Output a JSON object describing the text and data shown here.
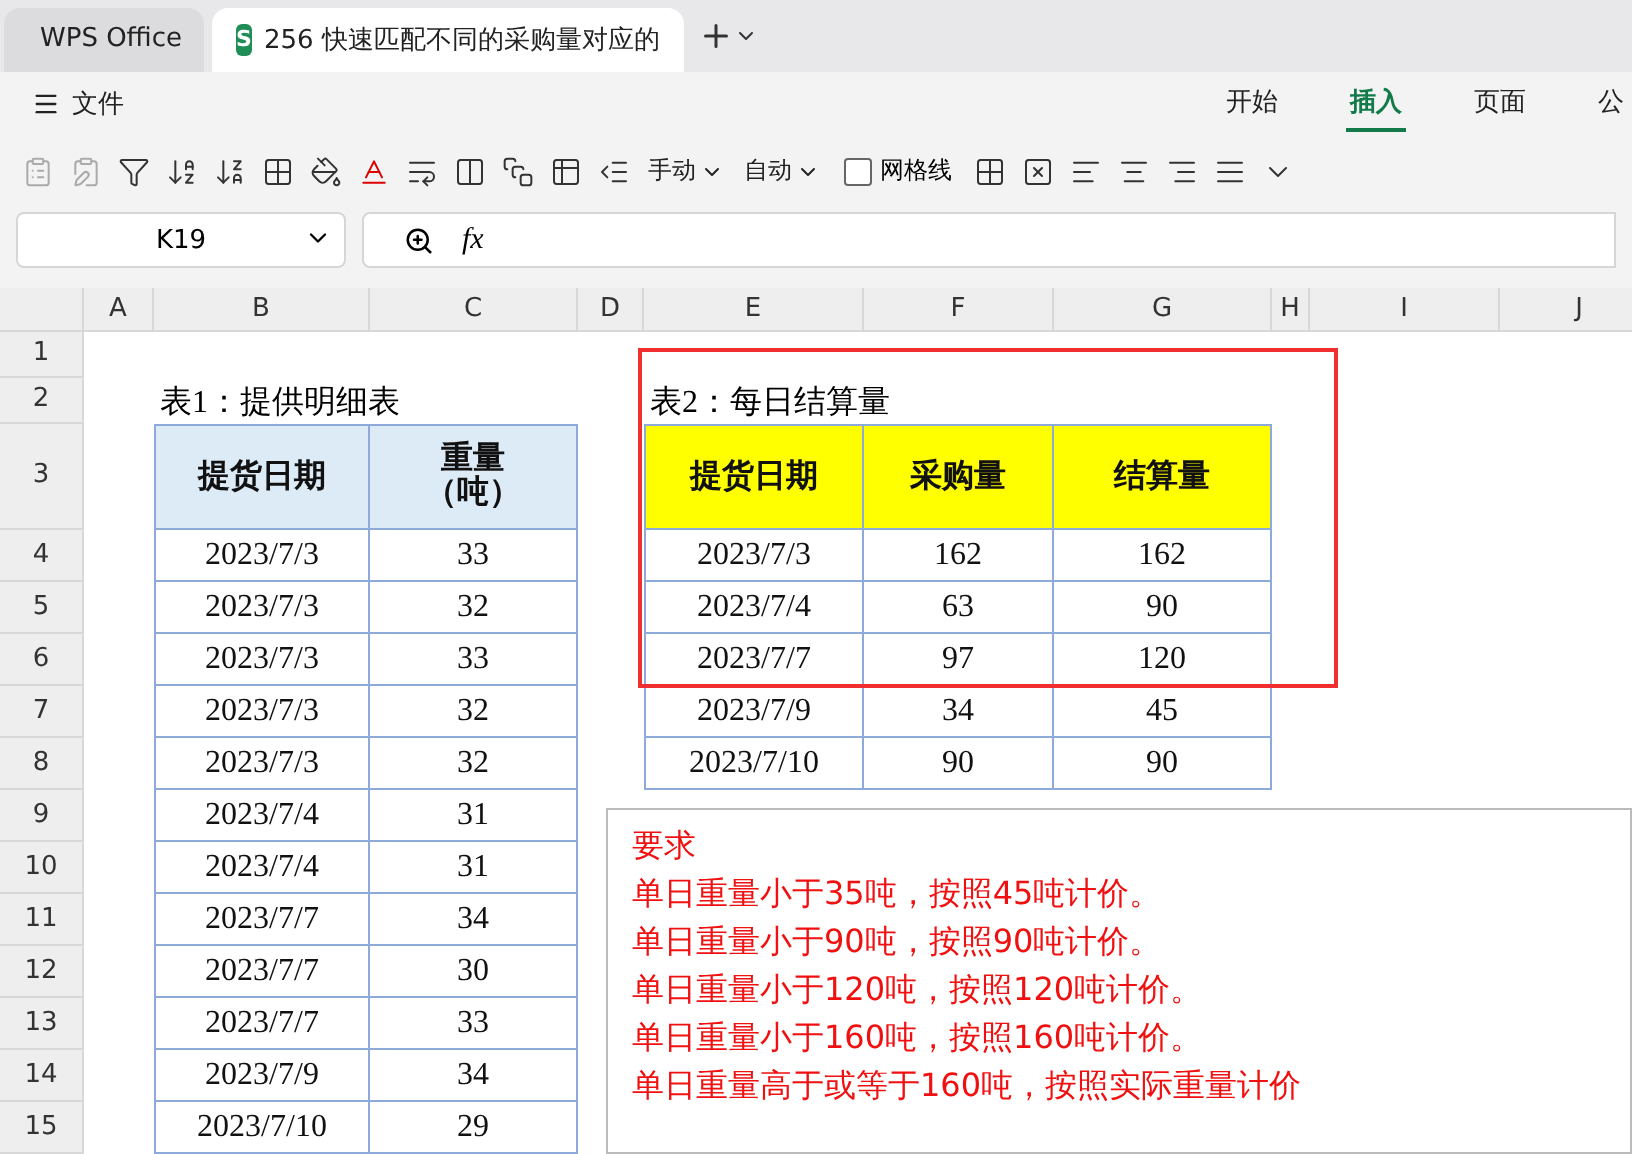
{
  "tabs": [
    {
      "kind": "home",
      "label": "WPS Office",
      "selected": false
    },
    {
      "kind": "doc",
      "badge": "S",
      "label": "256 快速匹配不同的采购量对应的",
      "selected": true
    }
  ],
  "menu": {
    "label": "文件"
  },
  "ribbon_tabs": [
    {
      "label": "开始",
      "selected": false
    },
    {
      "label": "插入",
      "selected": true
    },
    {
      "label": "页面",
      "selected": false
    },
    {
      "label": "公",
      "selected": false
    }
  ],
  "toolbar": [
    {
      "kind": "dropdown",
      "label": "手动"
    },
    {
      "kind": "dropdown",
      "label": "自动"
    },
    {
      "kind": "checkbox",
      "label": "网格线",
      "checked": false
    }
  ],
  "name_box": "K19",
  "formula_label": "fx",
  "sheet": {
    "columns": [
      "A",
      "B",
      "C",
      "D",
      "E",
      "F",
      "G",
      "H",
      "I",
      "J"
    ],
    "rows": [
      "1",
      "2",
      "3",
      "4",
      "5",
      "6",
      "7",
      "8",
      "9",
      "10",
      "11",
      "12",
      "13",
      "14",
      "15"
    ],
    "table1": {
      "title": "表1：提供明细表",
      "headers": [
        [
          "提货日期"
        ],
        [
          "重量",
          "（吨）"
        ]
      ],
      "rows": [
        [
          "2023/7/3",
          "33"
        ],
        [
          "2023/7/3",
          "32"
        ],
        [
          "2023/7/3",
          "33"
        ],
        [
          "2023/7/3",
          "32"
        ],
        [
          "2023/7/3",
          "32"
        ],
        [
          "2023/7/4",
          "31"
        ],
        [
          "2023/7/4",
          "31"
        ],
        [
          "2023/7/7",
          "34"
        ],
        [
          "2023/7/7",
          "30"
        ],
        [
          "2023/7/7",
          "33"
        ],
        [
          "2023/7/9",
          "34"
        ],
        [
          "2023/7/10",
          "29"
        ]
      ]
    },
    "table2": {
      "title": "表2：每日结算量",
      "headers": [
        "提货日期",
        "采购量",
        "结算量"
      ],
      "rows": [
        [
          "2023/7/3",
          "162",
          "162"
        ],
        [
          "2023/7/4",
          "63",
          "90"
        ],
        [
          "2023/7/7",
          "97",
          "120"
        ],
        [
          "2023/7/9",
          "34",
          "45"
        ],
        [
          "2023/7/10",
          "90",
          "90"
        ]
      ]
    },
    "note": [
      "要求",
      "单日重量小于35吨，按照45吨计价。",
      "单日重量小于90吨，按照90吨计价。",
      "单日重量小于120吨，按照120吨计价。",
      "单日重量小于160吨，按照160吨计价。",
      "单日重量高于或等于160吨，按照实际重量计价"
    ]
  }
}
